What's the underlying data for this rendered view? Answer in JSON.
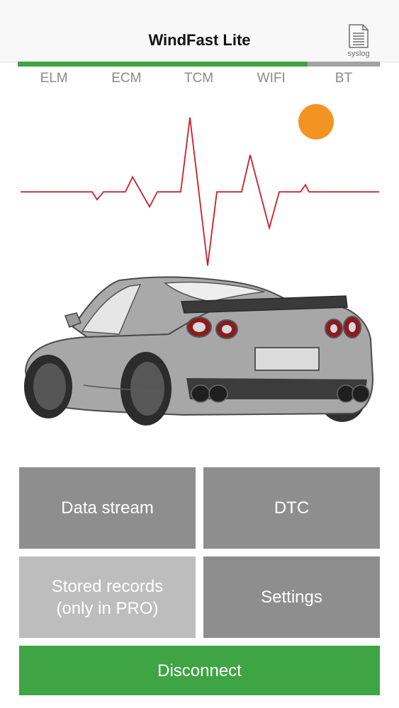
{
  "nav": {
    "title": "WindFast Lite",
    "syslog_label": "syslog"
  },
  "status": {
    "progress_fraction": 0.8,
    "items": [
      {
        "label": "ELM"
      },
      {
        "label": "ECM"
      },
      {
        "label": "TCM"
      },
      {
        "label": "WIFI"
      },
      {
        "label": "BT"
      }
    ]
  },
  "indicator": {
    "color": "#f39422"
  },
  "colors": {
    "accent_green": "#3fa443",
    "button_gray": "#8e8e8e",
    "button_disabled": "#bdbdbd",
    "pulse_red": "#c8202a"
  },
  "menu": {
    "data_stream": "Data stream",
    "dtc": "DTC",
    "stored_records": "Stored records\n(only in PRO)",
    "settings": "Settings",
    "disconnect": "Disconnect"
  }
}
